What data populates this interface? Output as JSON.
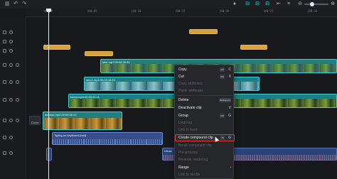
{
  "toolbar": {
    "icons": [
      "split-icon",
      "undo-icon",
      "redo-icon",
      "microphone-icon",
      "link-icon",
      "preview-icon",
      "align-icon",
      "zoom-out-icon",
      "zoom-in-icon"
    ]
  },
  "ruler": {
    "labels": [
      "00:00",
      "|00:05",
      "|00:10",
      "|00:15",
      "|00:20",
      "|00:25",
      "|00:30"
    ]
  },
  "clips": {
    "lake": "lake.mp4   00:00:39:25",
    "sea": "sea 1.mp4   00:00:16:24",
    "forest": "forest.mp4   00:00:01:11",
    "autumn": "autumn.mp4   00:00:06:19",
    "audio_typing": "Typing on keyboard (fast)",
    "urban": "Urban"
  },
  "cover": {
    "label": "Cover"
  },
  "context_menu": {
    "items": [
      {
        "label": "Copy",
        "key": "Ctrl",
        "key2": "C",
        "disabled": false
      },
      {
        "label": "Cut",
        "key": "Ctrl",
        "key2": "X",
        "disabled": false
      },
      {
        "label": "Copy attributes",
        "disabled": true
      },
      {
        "label": "Paste attributes",
        "disabled": true
      },
      {
        "label": "Delete",
        "key": "Backspace",
        "disabled": false
      },
      {
        "label": "Deactivate clip",
        "key2": "V",
        "disabled": false
      },
      {
        "label": "Group",
        "key": "Ctrl",
        "key2": "G",
        "disabled": false
      },
      {
        "label": "Ungroup",
        "disabled": true
      },
      {
        "label": "Link to track",
        "disabled": true
      },
      {
        "label": "Create compound clip",
        "key": "Alt",
        "key2": "G",
        "disabled": false,
        "highlight": true
      },
      {
        "label": "Break compound clip",
        "disabled": true
      },
      {
        "label": "Pre-process",
        "disabled": true
      },
      {
        "label": "Reverse rendering",
        "disabled": true
      },
      {
        "label": "Range",
        "disabled": false
      },
      {
        "label": "Link to media",
        "disabled": true
      }
    ]
  },
  "colors": {
    "accent": "#32d3e0",
    "video_clip": "#1f8f8f",
    "text_clip": "#d7a23a",
    "audio_clip": "#3b5fa8",
    "highlight_border": "#e0372e"
  }
}
